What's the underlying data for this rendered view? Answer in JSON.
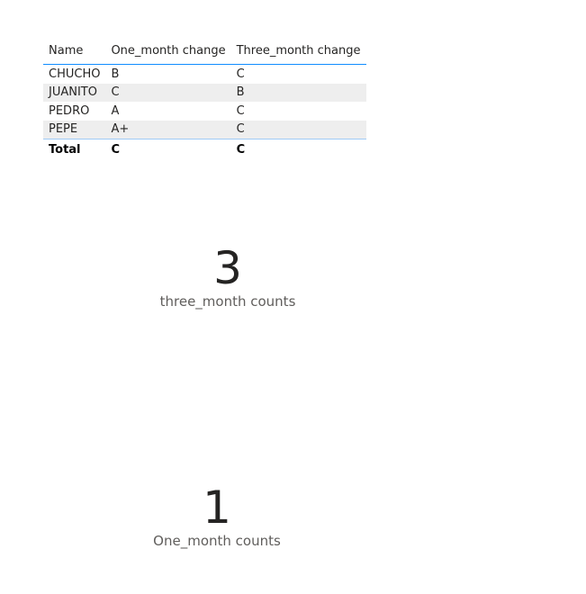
{
  "table": {
    "headers": [
      "Name",
      "One_month change",
      "Three_month change"
    ],
    "rows": [
      [
        "CHUCHO",
        "B",
        "C"
      ],
      [
        "JUANITO",
        "C",
        "B"
      ],
      [
        "PEDRO",
        "A",
        "C"
      ],
      [
        "PEPE",
        "A+",
        "C"
      ]
    ],
    "total": [
      "Total",
      "C",
      "C"
    ]
  },
  "cards": {
    "three_month": {
      "value": "3",
      "label": "three_month counts"
    },
    "one_month": {
      "value": "1",
      "label": "One_month counts"
    }
  },
  "colors": {
    "header_rule": "#118DFF",
    "band": "#EEEEEE"
  }
}
